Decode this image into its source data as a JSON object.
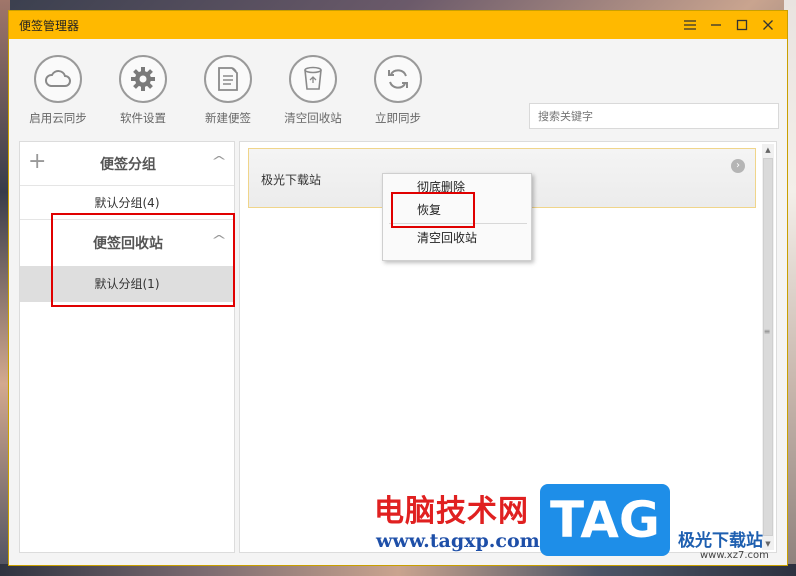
{
  "window": {
    "title": "便签管理器"
  },
  "toolbar": {
    "buttons": [
      {
        "label": "启用云同步",
        "icon": "cloud-icon"
      },
      {
        "label": "软件设置",
        "icon": "gear-icon"
      },
      {
        "label": "新建便签",
        "icon": "new-note-icon"
      },
      {
        "label": "清空回收站",
        "icon": "recycle-bin-icon"
      },
      {
        "label": "立即同步",
        "icon": "sync-icon"
      }
    ],
    "search_placeholder": "搜索关键字"
  },
  "sidebar": {
    "groups_title": "便签分组",
    "groups": [
      {
        "label": "默认分组(4)"
      }
    ],
    "recycle_title": "便签回收站",
    "recycle_groups": [
      {
        "label": "默认分组(1)",
        "selected": true
      }
    ]
  },
  "notes": [
    {
      "title": "极光下载站"
    }
  ],
  "context_menu": {
    "items": [
      {
        "label": "彻底删除"
      },
      {
        "label": "恢复",
        "highlighted": true
      },
      {
        "label": "清空回收站"
      }
    ]
  },
  "watermark": {
    "site_cn": "电脑技术网",
    "site_url": "www.tagxp.com",
    "logo_text": "TAG",
    "site2_cn": "极光下载站",
    "site2_url": "www.xz7.com"
  },
  "colors": {
    "titlebar": "#ffb900",
    "highlight_box": "#e00000"
  }
}
